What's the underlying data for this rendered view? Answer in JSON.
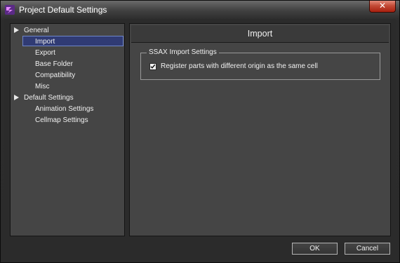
{
  "window": {
    "title": "Project Default Settings",
    "close_label": "✕"
  },
  "tree": {
    "general": "General",
    "import": "Import",
    "export": "Export",
    "base_folder": "Base Folder",
    "compatibility": "Compatibility",
    "misc": "Misc",
    "default_settings": "Default Settings",
    "animation_settings": "Animation Settings",
    "cellmap_settings": "Cellmap Settings",
    "selected": "Import"
  },
  "main": {
    "header": "Import",
    "group_title": "SSAX Import Settings",
    "checkbox_label": "Register parts with different origin as the same cell",
    "checkbox_checked": true
  },
  "footer": {
    "ok_label": "OK",
    "cancel_label": "Cancel"
  },
  "colors": {
    "selection_fill": "#303b74",
    "selection_border": "#6f86c8",
    "panel_bg": "#454545",
    "window_bg": "#2b2b2b"
  },
  "icons": {
    "app": "app-logo-icon",
    "close": "close-icon",
    "expand": "expand-arrow-icon",
    "check": "checkmark-icon"
  }
}
